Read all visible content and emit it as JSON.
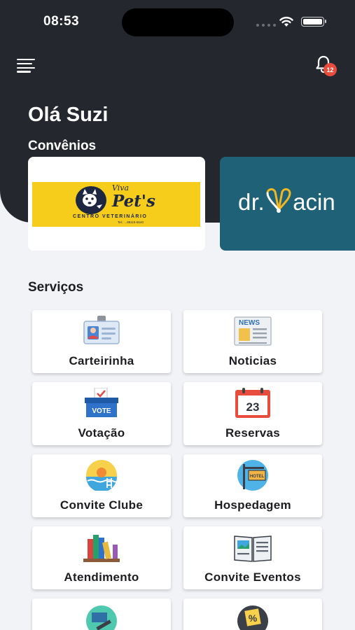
{
  "status_bar": {
    "time": "08:53"
  },
  "header": {
    "notification_count": "12",
    "greeting": "Olá Suzi",
    "partners_title": "Convênios"
  },
  "partners": [
    {
      "brand_top": "Viva",
      "brand": "Pet's",
      "subtitle": "CENTRO VETERINÁRIO",
      "phone": "Tel.: ...99115-5540"
    },
    {
      "brand_pre": "dr.",
      "brand_heart": "V",
      "brand_post": "acin"
    }
  ],
  "services": {
    "title": "Serviços",
    "items": [
      {
        "label": "Carteirinha",
        "icon": "id-card-icon"
      },
      {
        "label": "Noticias",
        "icon": "newspaper-icon",
        "icon_text": "NEWS"
      },
      {
        "label": "Votação",
        "icon": "ballot-box-icon",
        "icon_text": "VOTE"
      },
      {
        "label": "Reservas",
        "icon": "calendar-icon",
        "icon_text": "23"
      },
      {
        "label": "Convite Clube",
        "icon": "pool-icon"
      },
      {
        "label": "Hospedagem",
        "icon": "hotel-sign-icon",
        "icon_text": "HOTEL"
      },
      {
        "label": "Atendimento",
        "icon": "books-icon"
      },
      {
        "label": "Convite Eventos",
        "icon": "open-book-icon"
      },
      {
        "label": "",
        "icon": "gavel-icon"
      },
      {
        "label": "",
        "icon": "discount-tag-icon",
        "icon_text": "%"
      }
    ]
  },
  "colors": {
    "header_bg": "#24272d",
    "page_bg": "#f2f3f7",
    "badge": "#e74c3c",
    "vivapets_yellow": "#f7cd1b",
    "drvacin_teal": "#1f6277"
  }
}
